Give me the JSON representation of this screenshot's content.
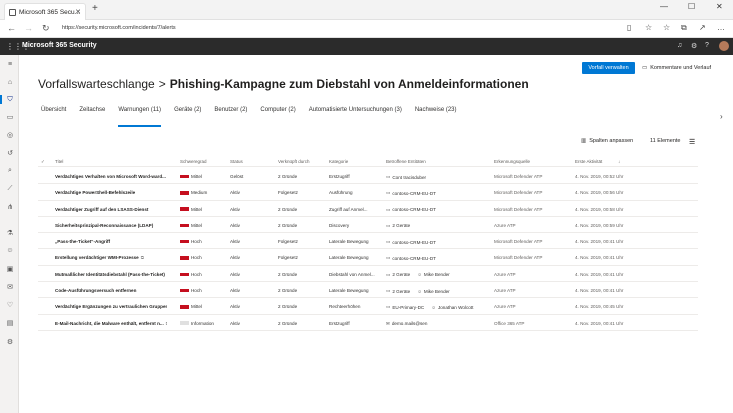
{
  "browser": {
    "tab_title": "Microsoft 365 Secu...",
    "url": "https://security.microsoft.com/incidents/7/alerts"
  },
  "app": {
    "title": "Microsoft 365 Security"
  },
  "page": {
    "breadcrumb_parent": "Vorfallswarteschlange",
    "separator": ">",
    "incident_title": "Phishing-Kampagne zum Diebstahl von Anmeldeinformationen",
    "primary_button": "Vorfall verwalten",
    "comments_button": "Kommentare und Verlauf"
  },
  "tabs": [
    {
      "label": "Übersicht"
    },
    {
      "label": "Zeitachse"
    },
    {
      "label": "Warnungen (11)"
    },
    {
      "label": "Geräte (2)"
    },
    {
      "label": "Benutzer (2)"
    },
    {
      "label": "Computer (2)"
    },
    {
      "label": "Automatisierte Untersuchungen (3)"
    },
    {
      "label": "Nachweise (23)"
    }
  ],
  "toolbar": {
    "customize_columns": "Spalten anpassen",
    "count": "11 Elemente"
  },
  "columns": {
    "title": "Titel",
    "severity": "Schweregrad",
    "status": "Status",
    "detected_by": "Verknüpft durch",
    "category": "Kategorie",
    "entities": "Betroffene Entitäten",
    "source": "Erkennungsquelle",
    "last_activity": "Erste Aktivität"
  },
  "rows": [
    {
      "title": "Verdächtiges Verhalten von Microsoft Word-ward...",
      "severity": "Mittel",
      "sev_level": 3,
      "status": "Gelöst",
      "via": "2 Gründe",
      "category": "Erstzugriff",
      "ent_icon": "device-icon",
      "entity": "Cont tracisduber",
      "entity2": "",
      "source": "Microsoft Defender ATP",
      "time": "4. Nov. 2019, 00:52 Uhr",
      "ext": false
    },
    {
      "title": "Verdächtige PowerShell-Befehlszeile",
      "severity": "Medium",
      "sev_level": 3,
      "status": "Aktiv",
      "via": "Folgesetz",
      "category": "Ausführung",
      "ent_icon": "device-icon",
      "entity": "contoso-CRM-EU-DT",
      "entity2": "",
      "source": "Microsoft Defender ATP",
      "time": "4. Nov. 2019, 00:56 Uhr",
      "ext": false
    },
    {
      "title": "Verdächtiger Zugriff auf den LSASS-Dienst",
      "severity": "Mittel",
      "sev_level": 3,
      "status": "Aktiv",
      "via": "2 Gründe",
      "category": "Zugriff auf Anmel...",
      "ent_icon": "device-icon",
      "entity": "contoso-CRM-EU-DT",
      "entity2": "",
      "source": "Microsoft Defender ATP",
      "time": "4. Nov. 2019, 00:58 Uhr",
      "ext": false
    },
    {
      "title": "Sicherheitsprinzipal-Reconnaissance (LDAP)",
      "severity": "Mittel",
      "sev_level": 3,
      "status": "Aktiv",
      "via": "2 Gründe",
      "category": "Discovery",
      "ent_icon": "device-icon",
      "entity": "2 Geräte",
      "entity2": "",
      "source": "Azure ATP",
      "time": "4. Nov. 2019, 00:59 Uhr",
      "ext": false
    },
    {
      "title": "„Pass-the-Ticket“-Angriff",
      "severity": "Hoch",
      "sev_level": 3,
      "status": "Aktiv",
      "via": "Folgesetz",
      "category": "Laterale Bewegung",
      "ent_icon": "device-icon",
      "entity": "contoso-CRM-EU-DT",
      "entity2": "",
      "source": "Microsoft Defender ATP",
      "time": "4. Nov. 2019, 00:41 Uhr",
      "ext": false
    },
    {
      "title": "Erstellung verdächtiger WMI-Prozesse",
      "severity": "Hoch",
      "sev_level": 3,
      "status": "Aktiv",
      "via": "Folgesetz",
      "category": "Laterale Bewegung",
      "ent_icon": "device-icon",
      "entity": "contoso-CRM-EU-DT",
      "entity2": "",
      "source": "Microsoft Defender ATP",
      "time": "4. Nov. 2019, 00:41 Uhr",
      "ext": true
    },
    {
      "title": "Mutmaßlicher Identitätsdiebstahl (Pass-the-Ticket)",
      "severity": "Hoch",
      "sev_level": 3,
      "status": "Aktiv",
      "via": "2 Gründe",
      "category": "Diebstahl von Anmel...",
      "ent_icon": "device-icon",
      "entity": "2 Geräte",
      "entity2": "Mike Bender",
      "source": "Azure ATP",
      "time": "4. Nov. 2019, 00:41 Uhr",
      "ext": true
    },
    {
      "title": "Code-Ausführungsversuch entfernen",
      "severity": "Hoch",
      "sev_level": 3,
      "status": "Aktiv",
      "via": "2 Gründe",
      "category": "Laterale Bewegung",
      "ent_icon": "device-icon",
      "entity": "2 Geräte",
      "entity2": "Mike Bender",
      "source": "Azure ATP",
      "time": "4. Nov. 2019, 00:41 Uhr",
      "ext": false
    },
    {
      "title": "Verdächtige Ergänzungen zu vertraulichen Gruppen",
      "severity": "Mittel",
      "sev_level": 3,
      "status": "Aktiv",
      "via": "2 Gründe",
      "category": "Rechteerhöhen",
      "ent_icon": "device-icon",
      "entity": "EU-Primary-DC",
      "entity2": "Jonathan Wolcott",
      "source": "Azure ATP",
      "time": "4. Nov. 2019, 00:45 Uhr",
      "ext": false
    },
    {
      "title": "E-Mail-Nachricht, die Malware enthält, entfernt n...",
      "severity": "Information",
      "sev_level": 0,
      "status": "Aktiv",
      "via": "2 Gründe",
      "category": "Erstzugriff",
      "ent_icon": "mail-icon",
      "entity": "demo.mails@sen",
      "entity2": "",
      "source": "Office 365 ATP",
      "time": "4. Nov. 2019, 00:41 Uhr",
      "ext": true
    }
  ],
  "colors": {
    "accent": "#0078d4",
    "header_bg": "#2b2b2b",
    "severity_high": "#c50f1f"
  }
}
